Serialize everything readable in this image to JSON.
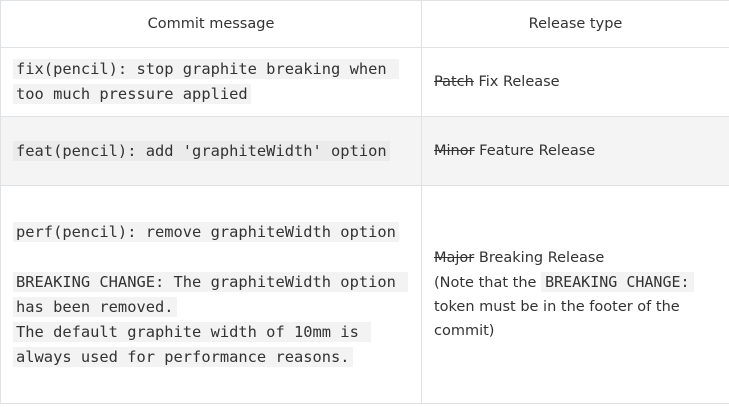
{
  "headers": {
    "commit_message": "Commit message",
    "release_type": "Release type"
  },
  "rows": [
    {
      "message": "fix(pencil): stop graphite breaking when too much pressure applied",
      "release_struck": "Patch",
      "release_label": "Fix Release"
    },
    {
      "message": "feat(pencil): add 'graphiteWidth' option",
      "release_struck": "Minor",
      "release_label": "Feature Release"
    },
    {
      "message": "perf(pencil): remove graphiteWidth option",
      "breaking_line1": "BREAKING CHANGE: The graphiteWidth option has been removed.",
      "breaking_line2": "The default graphite width of 10mm is always used for performance reasons.",
      "release_struck": "Major",
      "release_label": "Breaking Release",
      "note_prefix": "(Note that the",
      "note_token": "BREAKING CHANGE:",
      "note_suffix": "token must be in the footer of the commit)"
    }
  ]
}
